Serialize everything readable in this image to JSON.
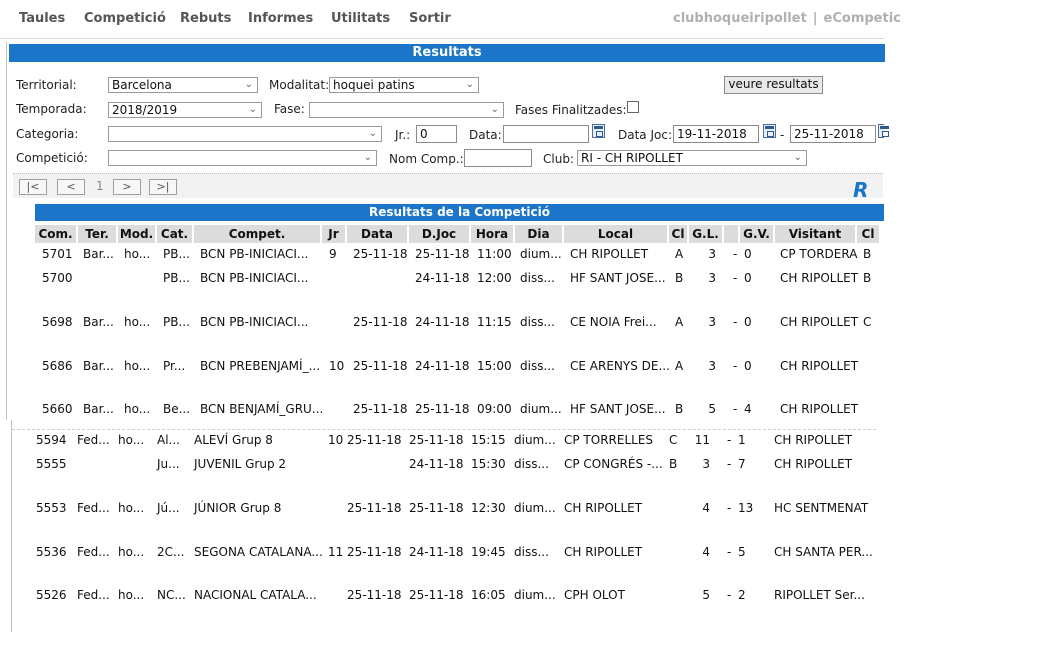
{
  "nav": {
    "items": [
      "Taules",
      "Competició",
      "Rebuts",
      "Informes",
      "Utilitats",
      "Sortir"
    ],
    "user": "clubhoqueiripollet",
    "separator": "|",
    "app": "eCompetic"
  },
  "panel": {
    "title": "Resultats"
  },
  "filters": {
    "territorial_label": "Territorial:",
    "territorial_value": "Barcelona",
    "modalitat_label": "Modalitat:",
    "modalitat_value": "hoquei patins",
    "view_button": "veure resultats",
    "temporada_label": "Temporada:",
    "temporada_value": "2018/2019",
    "fase_label": "Fase:",
    "fase_value": "",
    "fases_fin_label": "Fases Finalitzades:",
    "categoria_label": "Categoria:",
    "categoria_value": "",
    "jr_label": "Jr.:",
    "jr_value": "0",
    "data_label": "Data:",
    "data_value": "",
    "datajoc_label": "Data Joc:",
    "datajoc_from": "19-11-2018",
    "datajoc_dash": "-",
    "datajoc_to": "25-11-2018",
    "competicio_label": "Competició:",
    "competicio_value": "",
    "nomcomp_label": "Nom Comp.:",
    "nomcomp_value": "",
    "club_label": "Club:",
    "club_value": "RI - CH RIPOLLET"
  },
  "pager": {
    "first": "|<",
    "prev": "<",
    "page": "1",
    "next": ">",
    "last": ">|",
    "logo": "R"
  },
  "results": {
    "title": "Resultats de la Competició",
    "headers": [
      "Com.",
      "Ter.",
      "Mod.",
      "Cat.",
      "Compet.",
      "Jr",
      "Data",
      "D.Joc",
      "Hora",
      "Dia",
      "Local",
      "Cl",
      "G.L.",
      "",
      "G.V.",
      "Visitant",
      "Cl"
    ],
    "rows": [
      {
        "com": "5701",
        "ter": "Bar...",
        "mod": "ho...",
        "cat": "PB...",
        "compet": "BCN PB-INICIACI...",
        "jr": "9",
        "data": "25-11-18",
        "djoc": "25-11-18",
        "hora": "11:00",
        "dia": "dium...",
        "local": "CH RIPOLLET",
        "cl": "A",
        "gl": "3",
        "dash": "-",
        "gv": "0",
        "visitant": "CP TORDERA",
        "cl2": "B"
      },
      {
        "com": "5700",
        "ter": "",
        "mod": "",
        "cat": "PB...",
        "compet": "BCN PB-INICIACI...",
        "jr": "",
        "data": "",
        "djoc": "24-11-18",
        "hora": "12:00",
        "dia": "diss...",
        "local": "HF SANT JOSE...",
        "cl": "B",
        "gl": "3",
        "dash": "-",
        "gv": "0",
        "visitant": "CH RIPOLLET",
        "cl2": "B"
      },
      {
        "com": "5698",
        "ter": "Bar...",
        "mod": "ho...",
        "cat": "PB...",
        "compet": "BCN PB-INICIACI...",
        "jr": "",
        "data": "25-11-18",
        "djoc": "24-11-18",
        "hora": "11:15",
        "dia": "diss...",
        "local": "CE NOIA Frei...",
        "cl": "A",
        "gl": "3",
        "dash": "-",
        "gv": "0",
        "visitant": "CH RIPOLLET",
        "cl2": "C"
      },
      {
        "com": "5686",
        "ter": "Bar...",
        "mod": "ho...",
        "cat": "Pr...",
        "compet": "BCN PREBENJAMÍ_...",
        "jr": "10",
        "data": "25-11-18",
        "djoc": "24-11-18",
        "hora": "15:00",
        "dia": "diss...",
        "local": "CE ARENYS DE...",
        "cl": "A",
        "gl": "3",
        "dash": "-",
        "gv": "0",
        "visitant": "CH RIPOLLET",
        "cl2": ""
      },
      {
        "com": "5660",
        "ter": "Bar...",
        "mod": "ho...",
        "cat": "Be...",
        "compet": "BCN BENJAMÍ_GRU...",
        "jr": "",
        "data": "25-11-18",
        "djoc": "25-11-18",
        "hora": "09:00",
        "dia": "dium...",
        "local": "HF SANT JOSE...",
        "cl": "B",
        "gl": "5",
        "dash": "-",
        "gv": "4",
        "visitant": "CH RIPOLLET",
        "cl2": ""
      },
      {
        "com": "5594",
        "ter": "Fed...",
        "mod": "ho...",
        "cat": "Al...",
        "compet": "ALEVÍ Grup 8",
        "jr": "10",
        "data": "25-11-18",
        "djoc": "25-11-18",
        "hora": "15:15",
        "dia": "dium...",
        "local": "CP TORRELLES",
        "cl": "C",
        "gl": "11",
        "dash": "-",
        "gv": "1",
        "visitant": "CH RIPOLLET",
        "cl2": ""
      },
      {
        "com": "5555",
        "ter": "",
        "mod": "",
        "cat": "Ju...",
        "compet": "JUVENIL Grup 2",
        "jr": "",
        "data": "",
        "djoc": "24-11-18",
        "hora": "15:30",
        "dia": "diss...",
        "local": "CP CONGRÉS -...",
        "cl": "B",
        "gl": "3",
        "dash": "-",
        "gv": "7",
        "visitant": "CH RIPOLLET",
        "cl2": ""
      },
      {
        "com": "5553",
        "ter": "Fed...",
        "mod": "ho...",
        "cat": "Jú...",
        "compet": "JÚNIOR Grup 8",
        "jr": "",
        "data": "25-11-18",
        "djoc": "25-11-18",
        "hora": "12:30",
        "dia": "dium...",
        "local": "CH RIPOLLET",
        "cl": "",
        "gl": "4",
        "dash": "-",
        "gv": "13",
        "visitant": "HC SENTMENAT",
        "cl2": ""
      },
      {
        "com": "5536",
        "ter": "Fed...",
        "mod": "ho...",
        "cat": "2C...",
        "compet": "SEGONA CATALANA...",
        "jr": "11",
        "data": "25-11-18",
        "djoc": "24-11-18",
        "hora": "19:45",
        "dia": "diss...",
        "local": "CH RIPOLLET",
        "cl": "",
        "gl": "4",
        "dash": "-",
        "gv": "5",
        "visitant": "CH SANTA PER...",
        "cl2": ""
      },
      {
        "com": "5526",
        "ter": "Fed...",
        "mod": "ho...",
        "cat": "NC...",
        "compet": "NACIONAL CATALA...",
        "jr": "",
        "data": "25-11-18",
        "djoc": "25-11-18",
        "hora": "16:05",
        "dia": "dium...",
        "local": "CPH OLOT",
        "cl": "",
        "gl": "5",
        "dash": "-",
        "gv": "2",
        "visitant": "RIPOLLET Ser...",
        "cl2": ""
      }
    ]
  }
}
